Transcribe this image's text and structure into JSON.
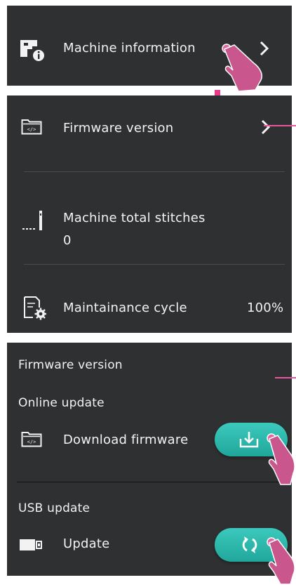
{
  "panel1": {
    "machine_information_label": "Machine information",
    "icons": [
      "sewing-machine-info-icon",
      "chevron-right-icon",
      "touch-hand-icon"
    ]
  },
  "panel2": {
    "firmware_version_label": "Firmware version",
    "total_stitches_label": "Machine total stitches",
    "total_stitches_value": "0",
    "maintenance_label": "Maintainance cycle",
    "maintenance_value": "100%",
    "icons": [
      "firmware-folder-icon",
      "chevron-right-icon",
      "needle-stitch-icon",
      "maintenance-gear-icon"
    ]
  },
  "panel3": {
    "title": "Firmware version",
    "online_section": "Online update",
    "download_label": "Download firmware",
    "usb_section": "USB update",
    "update_label": "Update",
    "icons": [
      "firmware-folder-icon",
      "download-icon",
      "usb-drive-icon",
      "refresh-icon",
      "touch-hand-icon"
    ]
  },
  "colors": {
    "panel_bg": "#2f3031",
    "text": "#f2f2f2",
    "accent_teal": "#2bb5a9",
    "annotation_pink": "#e8579e"
  }
}
